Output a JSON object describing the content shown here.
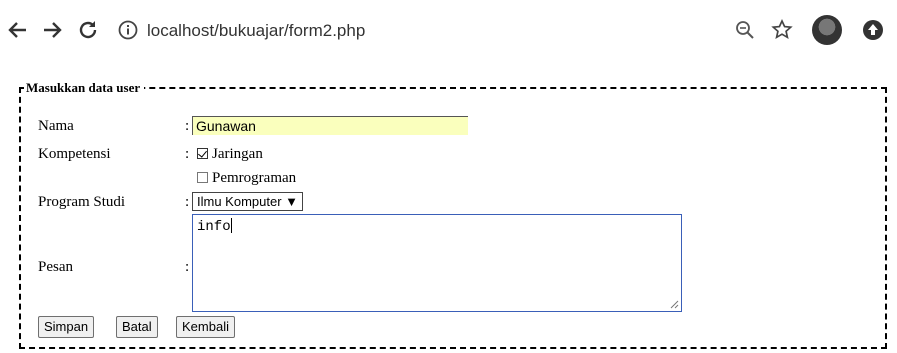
{
  "browser": {
    "url": "localhost/bukuajar/form2.php"
  },
  "form": {
    "legend": "Masukkan data user",
    "colon": ":",
    "nama": {
      "label": "Nama",
      "value": "Gunawan"
    },
    "kompetensi": {
      "label": "Kompetensi",
      "options": [
        {
          "label": "Jaringan",
          "checked": true
        },
        {
          "label": "Pemrograman",
          "checked": false
        }
      ]
    },
    "program_studi": {
      "label": "Program Studi",
      "selected": "Ilmu Komputer ▼"
    },
    "pesan": {
      "label": "Pesan",
      "value": "info"
    },
    "buttons": {
      "simpan": "Simpan",
      "batal": "Batal",
      "kembali": "Kembali"
    }
  }
}
